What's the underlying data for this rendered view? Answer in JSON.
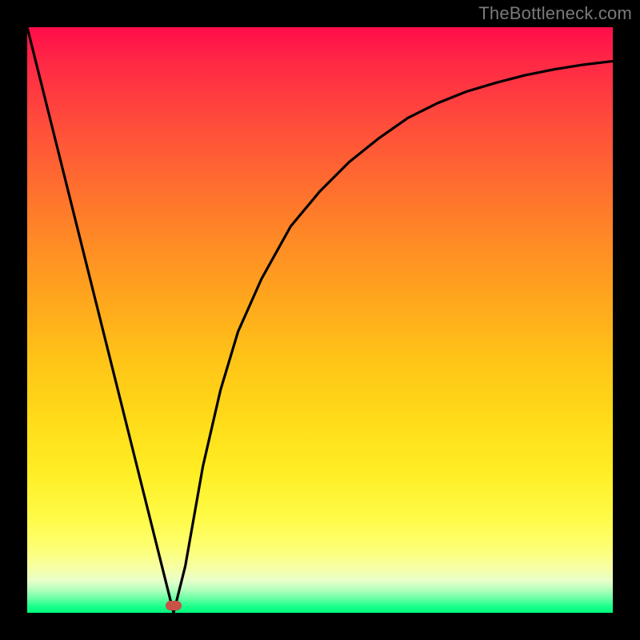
{
  "watermark": "TheBottleneck.com",
  "chart_data": {
    "type": "line",
    "title": "",
    "xlabel": "",
    "ylabel": "",
    "xlim": [
      0,
      100
    ],
    "ylim": [
      0,
      100
    ],
    "grid": false,
    "legend": false,
    "series": [
      {
        "name": "curve",
        "x": [
          0,
          5,
          10,
          15,
          20,
          23,
          25,
          27,
          30,
          33,
          36,
          40,
          45,
          50,
          55,
          60,
          65,
          70,
          75,
          80,
          85,
          90,
          95,
          100
        ],
        "y": [
          100,
          80,
          60,
          40,
          20,
          8,
          0,
          8,
          25,
          38,
          48,
          57,
          66,
          72,
          77,
          81,
          84.5,
          87,
          89,
          90.5,
          91.8,
          92.8,
          93.6,
          94.2
        ]
      }
    ],
    "marker": {
      "x": 25,
      "y": 0,
      "color": "#c95146"
    },
    "background_gradient": {
      "top": "#ff0d4a",
      "mid": "#ffd918",
      "bottom": "#00f97d"
    }
  }
}
